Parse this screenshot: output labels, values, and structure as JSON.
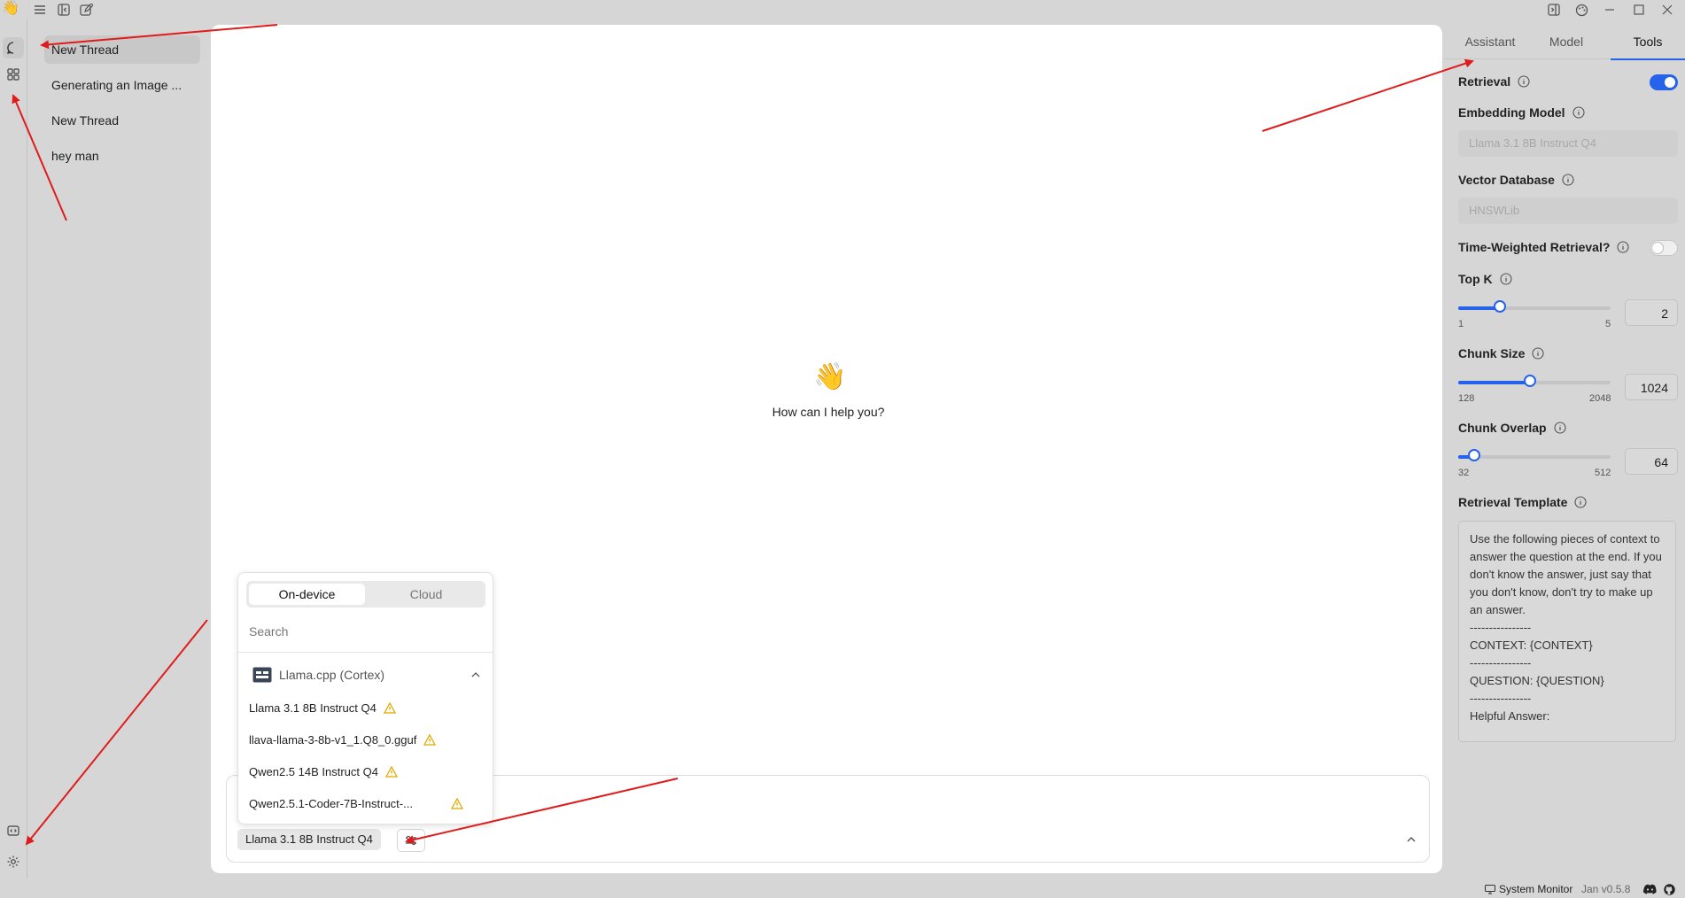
{
  "topbar": {
    "icons": [
      "wave-logo",
      "menu-icon",
      "collapse-sidebar-icon",
      "new-thread-icon",
      "toggle-right-panel-icon",
      "palette-icon",
      "minimize-icon",
      "maximize-icon",
      "close-icon"
    ],
    "logo": "👋"
  },
  "rail": {
    "items": [
      "chat-icon",
      "hub-grid-icon",
      "local-api-icon",
      "settings-icon"
    ]
  },
  "threads": [
    {
      "title": "New Thread",
      "active": true
    },
    {
      "title": "Generating an Image ...",
      "active": false
    },
    {
      "title": "New Thread",
      "active": false
    },
    {
      "title": "hey man",
      "active": false
    }
  ],
  "main": {
    "emoji": "👋",
    "greeting": "How can I help you?"
  },
  "chat": {
    "model_label": "Llama 3.1 8B Instruct Q4"
  },
  "model_dropdown": {
    "tabs": [
      "On-device",
      "Cloud"
    ],
    "active_tab": "On-device",
    "search_placeholder": "Search",
    "group": "Llama.cpp (Cortex)",
    "models": [
      "Llama 3.1 8B Instruct Q4",
      "llava-llama-3-8b-v1_1.Q8_0.gguf",
      "Qwen2.5 14B Instruct Q4",
      "Qwen2.5.1-Coder-7B-Instruct-..."
    ]
  },
  "right_panel": {
    "tabs": [
      "Assistant",
      "Model",
      "Tools"
    ],
    "active_tab": "Tools",
    "retrieval_label": "Retrieval",
    "retrieval_enabled": true,
    "embedding_label": "Embedding Model",
    "embedding_value": "Llama 3.1 8B Instruct Q4",
    "vector_label": "Vector Database",
    "vector_value": "HNSWLib",
    "time_weighted_label": "Time-Weighted Retrieval?",
    "time_weighted_enabled": false,
    "topk": {
      "label": "Top K",
      "min": "1",
      "max": "5",
      "value": "2"
    },
    "chunk_size": {
      "label": "Chunk Size",
      "min": "128",
      "max": "2048",
      "value": "1024"
    },
    "chunk_overlap": {
      "label": "Chunk Overlap",
      "min": "32",
      "max": "512",
      "value": "64"
    },
    "template_label": "Retrieval Template",
    "template_text": "Use the following pieces of context to answer the question at the end. If you don't know the answer, just say that you don't know, don't try to make up an answer.\n----------------\nCONTEXT: {CONTEXT}\n----------------\nQUESTION: {QUESTION}\n----------------\nHelpful Answer:"
  },
  "status": {
    "system_monitor": "System Monitor",
    "version": "Jan v0.5.8"
  },
  "colors": {
    "accent": "#2563eb",
    "annotation": "#e01b1b",
    "warning": "#e0a800"
  }
}
